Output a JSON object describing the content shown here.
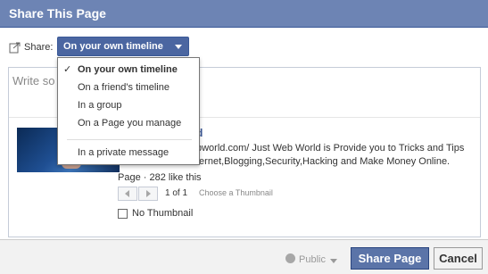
{
  "dialog": {
    "title": "Share This Page"
  },
  "share": {
    "label": "Share:",
    "selected": "On your own timeline",
    "menu": [
      {
        "label": "On your own timeline",
        "checked": true
      },
      {
        "label": "On a friend's timeline",
        "checked": false
      },
      {
        "label": "In a group",
        "checked": false
      },
      {
        "label": "On a Page you manage",
        "checked": false
      },
      {
        "label": "In a private message",
        "checked": false
      }
    ],
    "check_glyph": "✓"
  },
  "composer": {
    "placeholder_visible": "Write so"
  },
  "link": {
    "title_visible": "d",
    "desc_line1": "bworld.com/ Just Web World is Provide you to Tricks and Tips",
    "desc_line2": "ternet,Blogging,Security,Hacking and Make Money Online.",
    "meta": "Page · 282 like this"
  },
  "pager": {
    "count": "1 of 1",
    "choose": "Choose a Thumbnail"
  },
  "no_thumbnail": {
    "label": "No Thumbnail",
    "checked": false
  },
  "footer": {
    "audience": "Public",
    "share_button": "Share Page",
    "cancel_button": "Cancel"
  },
  "colors": {
    "header": "#6d84b4",
    "primary_button": "#5b74a8"
  }
}
